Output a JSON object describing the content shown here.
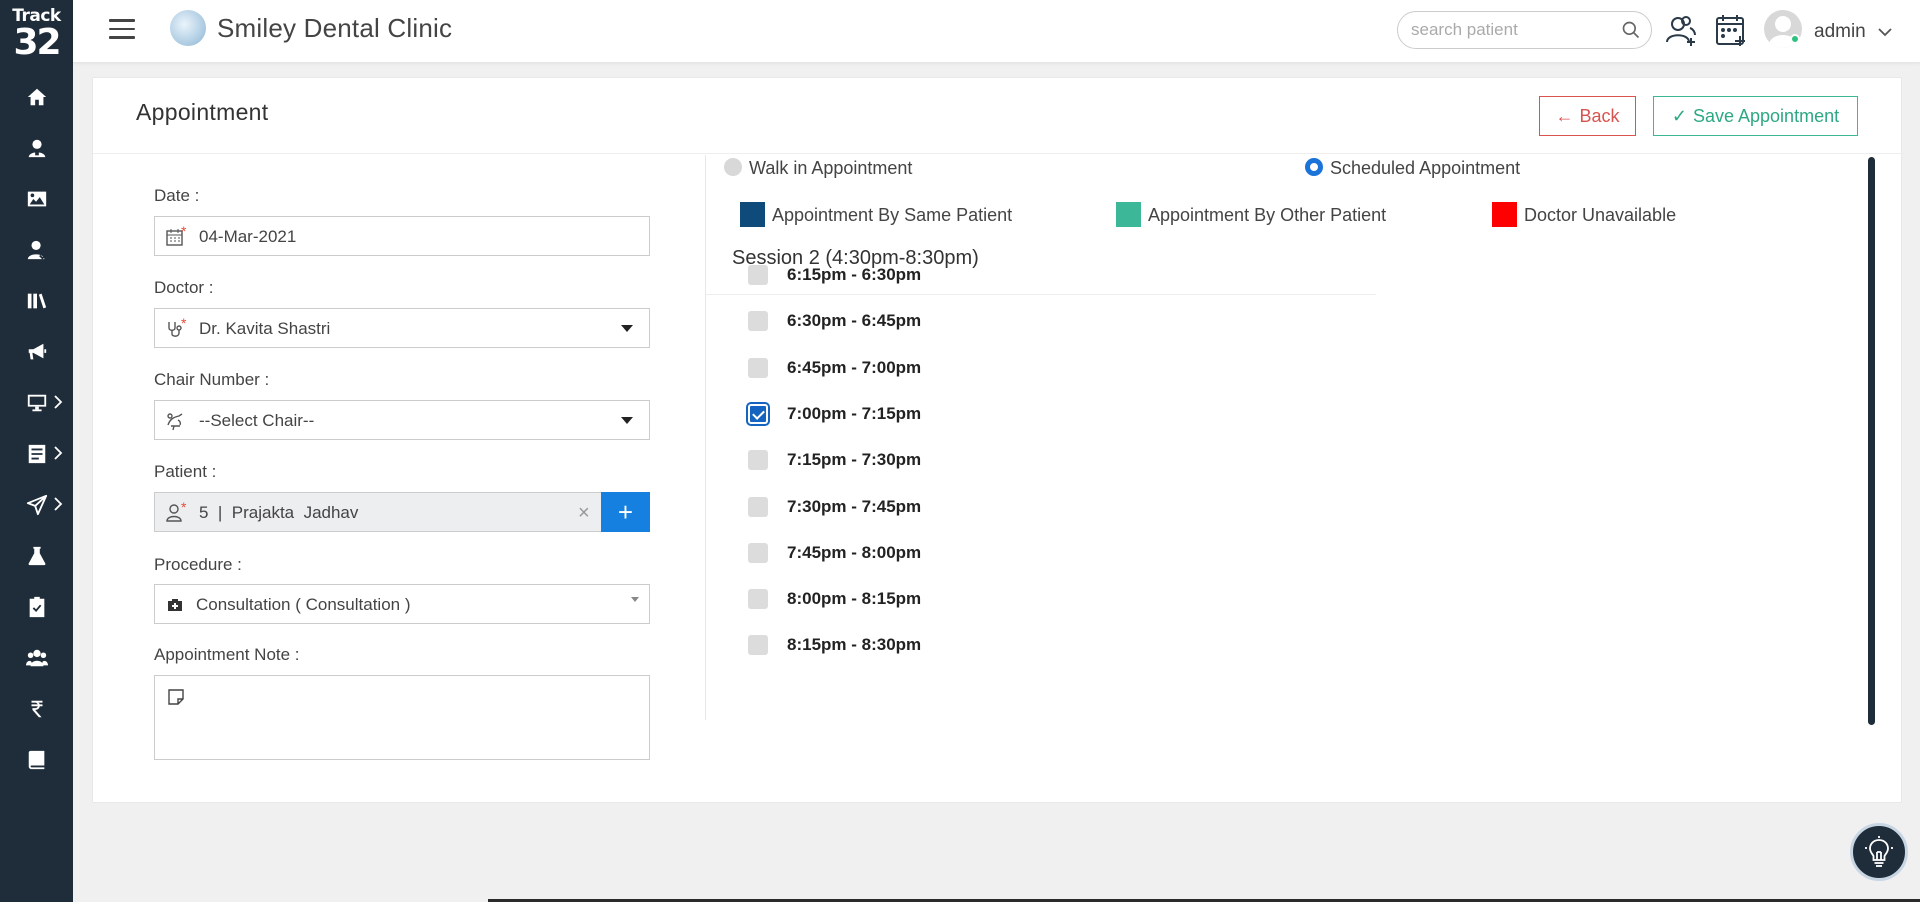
{
  "sidebar": {
    "logo_line1": "Track",
    "logo_line2": "32",
    "items": [
      {
        "icon": "home-icon"
      },
      {
        "icon": "patient-icon"
      },
      {
        "icon": "image-icon"
      },
      {
        "icon": "doctor-icon"
      },
      {
        "icon": "library-icon"
      },
      {
        "icon": "megaphone-icon"
      },
      {
        "icon": "monitor-icon",
        "expandable": true
      },
      {
        "icon": "report-icon",
        "expandable": true
      },
      {
        "icon": "send-icon",
        "expandable": true
      },
      {
        "icon": "flask-icon"
      },
      {
        "icon": "clipboard-check-icon"
      },
      {
        "icon": "users-icon"
      },
      {
        "icon": "rupee-icon"
      },
      {
        "icon": "book-icon"
      }
    ]
  },
  "header": {
    "clinic_name": "Smiley Dental Clinic",
    "search_placeholder": "search patient",
    "user_name": "admin"
  },
  "page": {
    "title": "Appointment",
    "back_label": "Back",
    "save_label": "Save Appointment"
  },
  "form": {
    "date_label": "Date :",
    "date_value": "04-Mar-2021",
    "doctor_label": "Doctor :",
    "doctor_value": "Dr. Kavita Shastri",
    "chair_label": "Chair Number :",
    "chair_value": "--Select Chair--",
    "patient_label": "Patient :",
    "patient_value": "5  |  Prajakta  Jadhav",
    "procedure_label": "Procedure :",
    "procedure_value": "Consultation ( Consultation )",
    "note_label": "Appointment Note :",
    "required_mark": "*",
    "clear_mark": "×",
    "add_mark": "+"
  },
  "appointment_type": {
    "walk_in_label": "Walk in Appointment",
    "scheduled_label": "Scheduled Appointment",
    "selected": "scheduled"
  },
  "legend": [
    {
      "label": "Appointment By Same Patient",
      "color": "#0e4a7a"
    },
    {
      "label": "Appointment By Other Patient",
      "color": "#3cb898"
    },
    {
      "label": "Doctor Unavailable",
      "color": "#ff0000"
    }
  ],
  "session": {
    "title": "Session 2 (4:30pm-8:30pm)",
    "slots": [
      {
        "label": "6:15pm - 6:30pm",
        "checked": false
      },
      {
        "label": "6:30pm - 6:45pm",
        "checked": false
      },
      {
        "label": "6:45pm - 7:00pm",
        "checked": false
      },
      {
        "label": "7:00pm - 7:15pm",
        "checked": true
      },
      {
        "label": "7:15pm - 7:30pm",
        "checked": false
      },
      {
        "label": "7:30pm - 7:45pm",
        "checked": false
      },
      {
        "label": "7:45pm - 8:00pm",
        "checked": false
      },
      {
        "label": "8:00pm - 8:15pm",
        "checked": false
      },
      {
        "label": "8:15pm - 8:30pm",
        "checked": false
      }
    ]
  },
  "colors": {
    "sidebar_bg": "#1f2d3a",
    "back_red": "#d9534f",
    "save_green": "#3cb894",
    "primary_blue": "#1580e0"
  }
}
